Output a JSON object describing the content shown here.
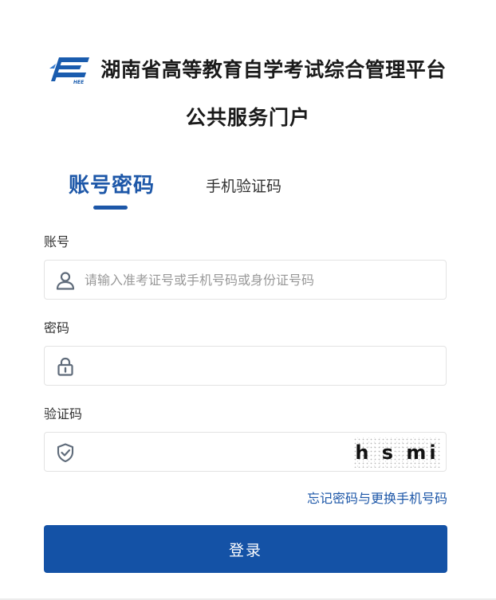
{
  "header": {
    "title": "湖南省高等教育自学考试综合管理平台",
    "subtitle": "公共服务门户",
    "logo_icon": "hee-logo-icon"
  },
  "tabs": [
    {
      "label": "账号密码",
      "active": true
    },
    {
      "label": "手机验证码",
      "active": false
    }
  ],
  "form": {
    "account": {
      "label": "账号",
      "placeholder": "请输入准考证号或手机号码或身份证号码",
      "value": "",
      "icon": "user-icon"
    },
    "password": {
      "label": "密码",
      "placeholder": "",
      "value": "",
      "icon": "lock-icon"
    },
    "captcha": {
      "label": "验证码",
      "placeholder": "",
      "value": "",
      "icon": "shield-check-icon",
      "image_text": "h s mi"
    },
    "forgot_link": "忘记密码与更换手机号码",
    "submit_label": "登录"
  },
  "colors": {
    "accent": "#1d57a8",
    "button": "#1452a6",
    "border": "#e3e3e3",
    "text": "#333333",
    "placeholder": "#999999"
  }
}
